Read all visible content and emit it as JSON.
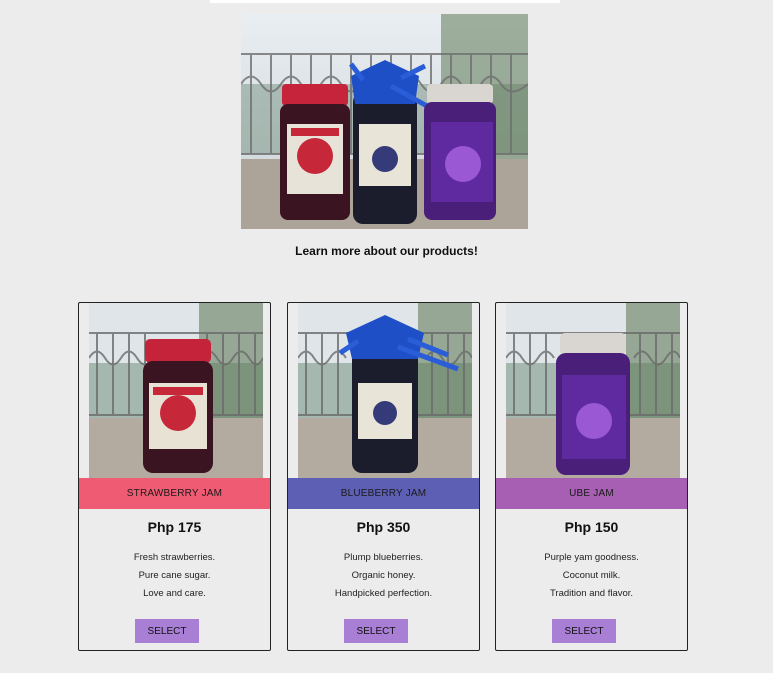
{
  "hero": {
    "caption": "Learn more about our products!",
    "image_icon": "jam-jars-photo"
  },
  "products": [
    {
      "name": "STRAWBERRY JAM",
      "price": "Php 175",
      "desc": [
        "Fresh strawberries.",
        "Pure cane sugar.",
        "Love and care."
      ],
      "button": "SELECT",
      "band_color": "#ef5b73",
      "image_icon": "strawberry-jam-jar-photo"
    },
    {
      "name": "BLUEBERRY JAM",
      "price": "Php 350",
      "desc": [
        "Plump blueberries.",
        "Organic honey.",
        "Handpicked perfection."
      ],
      "button": "SELECT",
      "band_color": "#5c5fb4",
      "image_icon": "blueberry-jam-jar-photo"
    },
    {
      "name": "UBE JAM",
      "price": "Php 150",
      "desc": [
        "Purple yam goodness.",
        "Coconut milk.",
        "Tradition and flavor."
      ],
      "button": "SELECT",
      "band_color": "#a65fb2",
      "image_icon": "ube-jam-jar-photo"
    }
  ],
  "colors": {
    "page_bg": "#ececec",
    "button_bg": "#a97fd6"
  }
}
